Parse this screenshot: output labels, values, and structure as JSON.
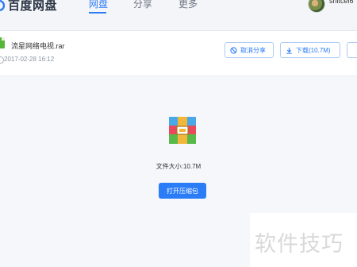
{
  "header": {
    "logo_text": "百度网盘",
    "nav": [
      {
        "label": "网盘",
        "active": true
      },
      {
        "label": "分享",
        "active": false
      },
      {
        "label": "更多",
        "active": false
      }
    ],
    "username": "snitcel6"
  },
  "file": {
    "name": "流星网络电视.rar",
    "time": "2017-02-28 16:12"
  },
  "actions": {
    "cancel_share": "取消分享",
    "download": "下载(10.7M)"
  },
  "preview": {
    "file_size_text": "文件大小:10.7M",
    "open_button": "打开压缩包"
  },
  "watermark": "软件技巧",
  "colors": {
    "accent": "#2b7cf7",
    "file_green": "#57b637"
  }
}
